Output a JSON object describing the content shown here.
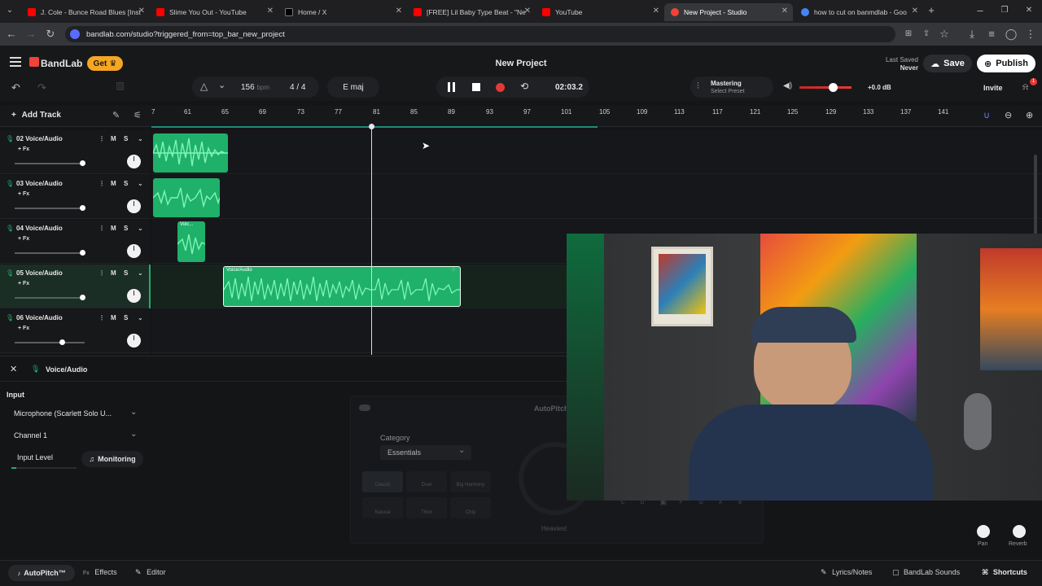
{
  "browser": {
    "tabs": [
      {
        "title": "J. Cole - Bunce Road Blues [Inst",
        "active": false,
        "icon": "youtube-icon"
      },
      {
        "title": "Slime You Out - YouTube",
        "active": false,
        "icon": "youtube-icon"
      },
      {
        "title": "Home / X",
        "active": false,
        "icon": "x-icon"
      },
      {
        "title": "[FREE] Lil Baby Type Beat - \"Ne",
        "active": false,
        "icon": "youtube-icon"
      },
      {
        "title": "YouTube",
        "active": false,
        "icon": "youtube-icon"
      },
      {
        "title": "New Project - Studio",
        "active": true,
        "icon": "bandlab-icon"
      },
      {
        "title": "how to cut on banmdlab - Goo",
        "active": false,
        "icon": "google-icon"
      }
    ],
    "url": "bandlab.com/studio?triggered_from=top_bar_new_project"
  },
  "header": {
    "brand": "BandLab",
    "get_label": "Get",
    "project_title": "New Project",
    "last_saved_label": "Last Saved",
    "last_saved_value": "Never",
    "save_label": "Save",
    "publish_label": "Publish"
  },
  "transport": {
    "bpm": "156",
    "bpm_unit": "bpm",
    "time_sig": "4 / 4",
    "key": "E maj",
    "time": "02:03.2",
    "mastering_label": "Mastering",
    "mastering_preset": "Select Preset",
    "master_volume": "+0.0 dB",
    "invite_label": "Invite",
    "notification_count": "1"
  },
  "ruler": {
    "add_track_label": "Add Track",
    "ticks": [
      "7",
      "61",
      "65",
      "69",
      "73",
      "77",
      "81",
      "85",
      "89",
      "93",
      "97",
      "101",
      "105",
      "109",
      "113",
      "117",
      "121",
      "125",
      "129",
      "133",
      "137",
      "141"
    ]
  },
  "tracks": [
    {
      "name": "02 Voice/Audio",
      "fx": "+ Fx",
      "m": "M",
      "s": "S",
      "clip_label": ""
    },
    {
      "name": "03 Voice/Audio",
      "fx": "+ Fx",
      "m": "M",
      "s": "S",
      "clip_label": ""
    },
    {
      "name": "04 Voice/Audio",
      "fx": "+ Fx",
      "m": "M",
      "s": "S",
      "clip_label": "Voic..."
    },
    {
      "name": "05 Voice/Audio",
      "fx": "+ Fx",
      "m": "M",
      "s": "S",
      "clip_label": "Voice/Audio"
    },
    {
      "name": "06 Voice/Audio",
      "fx": "+ Fx",
      "m": "M",
      "s": "S",
      "clip_label": ""
    }
  ],
  "panel": {
    "track_title": "Voice/Audio",
    "input_label": "Input",
    "input_device": "Microphone (Scarlett Solo U...",
    "channel": "Channel 1",
    "input_level_label": "Input Level",
    "monitoring_label": "Monitoring",
    "autopitch_title": "AutoPitch",
    "category_label": "Category",
    "category_value": "Essentials",
    "presets": [
      "Classic",
      "Duet",
      "Big Harmony",
      "Natural",
      "Third",
      "Chip"
    ],
    "heaviest_label": "Heaviest",
    "keys": [
      "C",
      "D",
      "E",
      "F",
      "G",
      "A",
      "B"
    ],
    "pan_label": "Pan",
    "reverb_label": "Reverb"
  },
  "bottombar": {
    "autopitch": "AutoPitch™",
    "effects": "Effects",
    "editor": "Editor",
    "lyrics": "Lyrics/Notes",
    "sounds": "BandLab Sounds",
    "shortcuts": "Shortcuts"
  },
  "colors": {
    "clip_green": "#1fb06a",
    "record_red": "#e53935",
    "accent_orange": "#f5a623",
    "brand_red": "#f0433a"
  }
}
